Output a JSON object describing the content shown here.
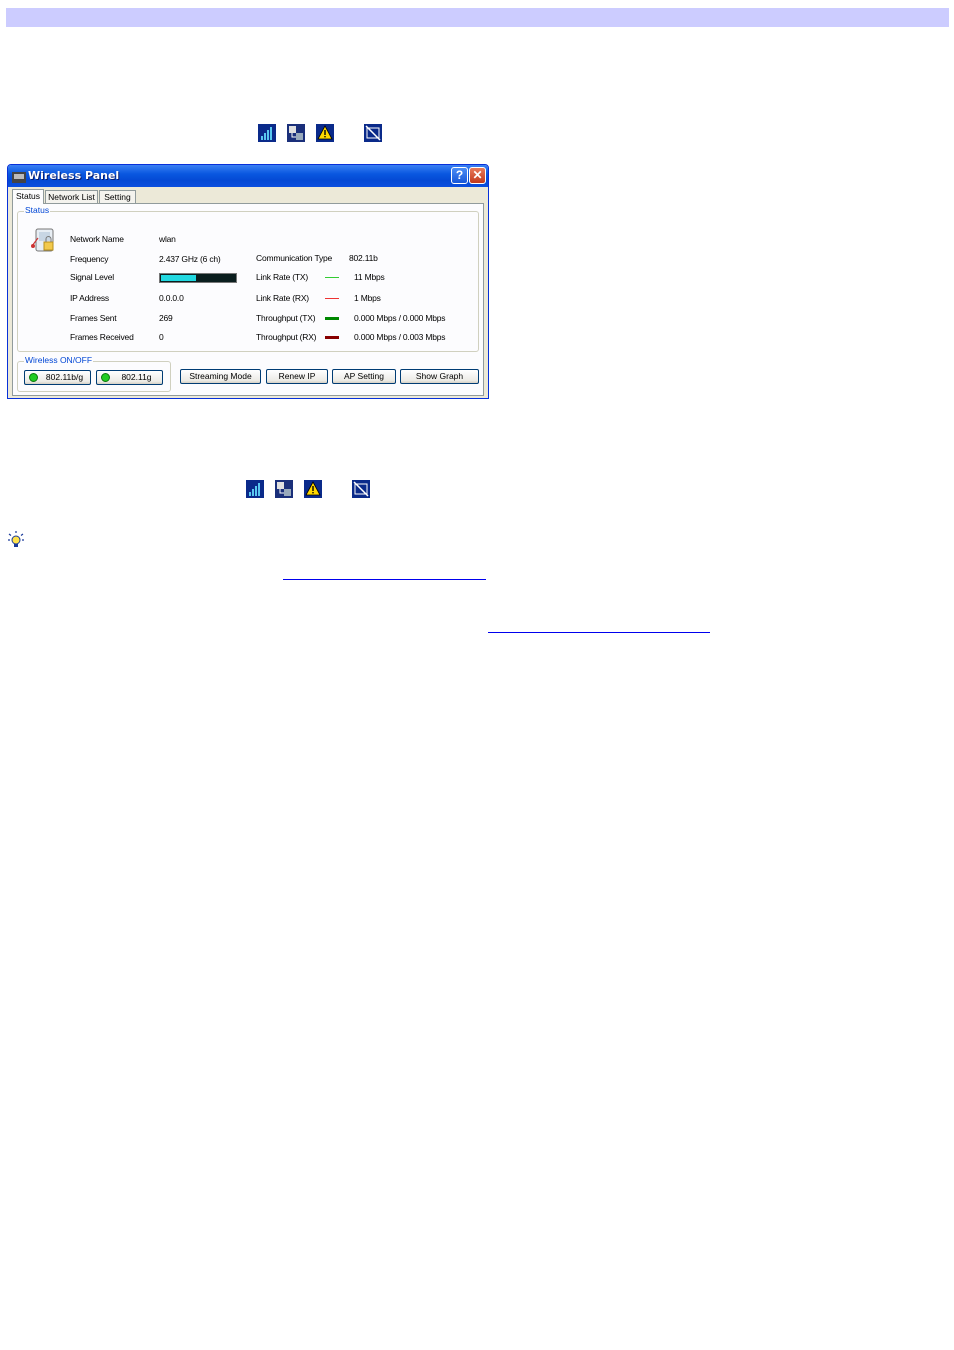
{
  "window": {
    "title": "Wireless Panel",
    "help_label": "?",
    "close_label": "✕"
  },
  "tabs": [
    {
      "label": "Status",
      "active": true
    },
    {
      "label": "Network List",
      "active": false
    },
    {
      "label": "Setting",
      "active": false
    }
  ],
  "status_group": {
    "legend": "Status",
    "left": [
      {
        "label": "Network Name",
        "value": "wlan"
      },
      {
        "label": "Frequency",
        "value": "2.437 GHz (6 ch)"
      },
      {
        "label": "Signal Level",
        "value": ""
      },
      {
        "label": "IP Address",
        "value": "0.0.0.0"
      },
      {
        "label": "Frames Sent",
        "value": "269"
      },
      {
        "label": "Frames Received",
        "value": "0"
      }
    ],
    "right": [
      {
        "label": "Communication Type",
        "value": "802.11b",
        "line_color": ""
      },
      {
        "label": "Link Rate (TX)",
        "value": "11 Mbps",
        "line_color": "#33cc33"
      },
      {
        "label": "Link Rate (RX)",
        "value": "1 Mbps",
        "line_color": "#ee3333"
      },
      {
        "label": "Throughput (TX)",
        "value": "0.000 Mbps / 0.000 Mbps",
        "line_color": "#008800"
      },
      {
        "label": "Throughput (RX)",
        "value": "0.000 Mbps / 0.003 Mbps",
        "line_color": "#880000"
      }
    ],
    "signal_level_fraction": 0.47
  },
  "wireless_group": {
    "legend": "Wireless ON/OFF",
    "buttons": [
      {
        "label": "802.11b/g",
        "led_color": "#22cc22"
      },
      {
        "label": "802.11g",
        "led_color": "#22cc22"
      }
    ]
  },
  "actions": {
    "streaming_mode": "Streaming Mode",
    "renew_ip": "Renew IP",
    "ap_setting": "AP Setting",
    "show_graph": "Show Graph"
  },
  "icons": [
    "signal-strength-icon",
    "network-connect-icon",
    "warning-icon",
    "disconnected-icon",
    "hint-lightbulb-icon"
  ],
  "colors": {
    "header_bar": "#ccccff",
    "title_bar": "#0a58e0",
    "link": "#0000ee"
  }
}
